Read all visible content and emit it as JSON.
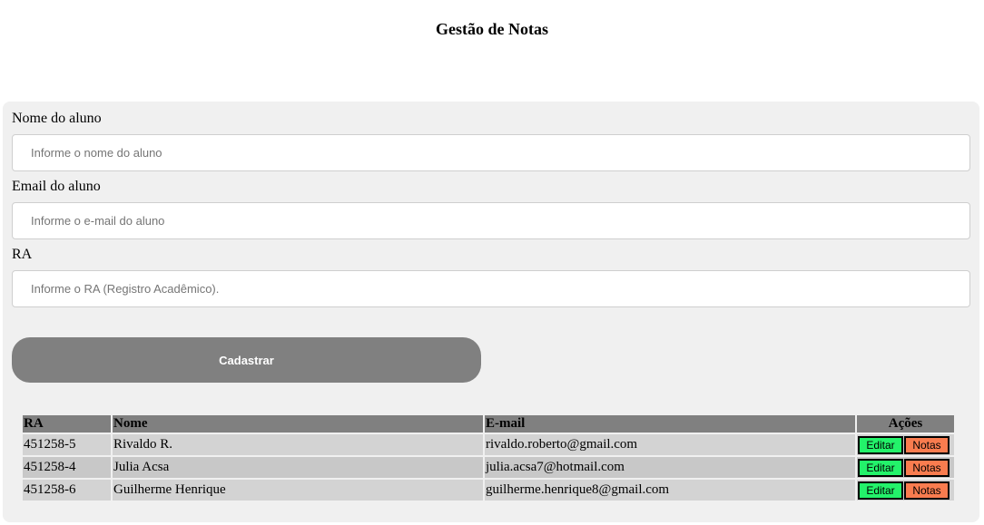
{
  "page": {
    "title": "Gestão de Notas"
  },
  "form": {
    "name_label": "Nome do aluno",
    "name_placeholder": "Informe o nome do aluno",
    "name_value": "",
    "email_label": "Email do aluno",
    "email_placeholder": "Informe o e-mail do aluno",
    "email_value": "",
    "ra_label": "RA",
    "ra_placeholder": "Informe o RA (Registro Acadêmico).",
    "ra_value": "",
    "submit_label": "Cadastrar"
  },
  "table": {
    "headers": {
      "ra": "RA",
      "name": "Nome",
      "email": "E-mail",
      "actions": "Ações"
    },
    "rows": [
      {
        "ra": "451258-5",
        "name": "Rivaldo R.",
        "email": "rivaldo.roberto@gmail.com",
        "edit": "Editar",
        "notes": "Notas"
      },
      {
        "ra": "451258-4",
        "name": "Julia Acsa",
        "email": "julia.acsa7@hotmail.com",
        "edit": "Editar",
        "notes": "Notas"
      },
      {
        "ra": "451258-6",
        "name": "Guilherme Henrique",
        "email": "guilherme.henrique8@gmail.com",
        "edit": "Editar",
        "notes": "Notas"
      }
    ]
  },
  "colors": {
    "panel_bg": "#f0f0f0",
    "header_bg": "#808080",
    "row_bg": "#d3d3d3",
    "submit_bg": "#808080",
    "edit_button": "#23f26a",
    "notes_button": "#f97c4f"
  }
}
